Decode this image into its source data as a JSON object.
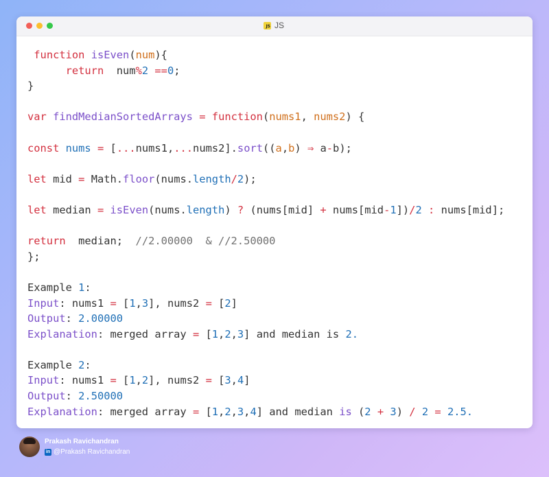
{
  "colors": {
    "keyword": "#d3303f",
    "function_name": "#7b4fc9",
    "parameter": "#d06f1b",
    "property": "#1f6fb6",
    "number": "#1f6fb6",
    "operator": "#d3303f",
    "comment": "#707070",
    "plain": "#333333",
    "dot_red": "#f25f58",
    "dot_yellow": "#fbbe2e",
    "dot_green": "#35c84a"
  },
  "window": {
    "tab_label": "JS",
    "tab_icon": "js-file-icon",
    "tab_icon_text": "JS"
  },
  "code": {
    "lines": [
      [
        {
          "t": " "
        },
        {
          "t": "function",
          "k": "keyword"
        },
        {
          "t": " "
        },
        {
          "t": "isEven",
          "k": "function_name"
        },
        {
          "t": "("
        },
        {
          "t": "num",
          "k": "parameter"
        },
        {
          "t": "){"
        }
      ],
      [
        {
          "t": "      "
        },
        {
          "t": "return",
          "k": "keyword"
        },
        {
          "t": "  num"
        },
        {
          "t": "%",
          "k": "operator"
        },
        {
          "t": "2",
          "k": "number"
        },
        {
          "t": " "
        },
        {
          "t": "==",
          "k": "operator"
        },
        {
          "t": "0",
          "k": "number"
        },
        {
          "t": ";"
        }
      ],
      [
        {
          "t": "}"
        }
      ],
      [],
      [
        {
          "t": "var",
          "k": "keyword"
        },
        {
          "t": " "
        },
        {
          "t": "findMedianSortedArrays",
          "k": "function_name"
        },
        {
          "t": " "
        },
        {
          "t": "=",
          "k": "operator"
        },
        {
          "t": " "
        },
        {
          "t": "function",
          "k": "keyword"
        },
        {
          "t": "("
        },
        {
          "t": "nums1",
          "k": "parameter"
        },
        {
          "t": ", "
        },
        {
          "t": "nums2",
          "k": "parameter"
        },
        {
          "t": ") {"
        }
      ],
      [],
      [
        {
          "t": "const",
          "k": "keyword"
        },
        {
          "t": " "
        },
        {
          "t": "nums",
          "k": "property"
        },
        {
          "t": " "
        },
        {
          "t": "=",
          "k": "operator"
        },
        {
          "t": " ["
        },
        {
          "t": "...",
          "k": "operator"
        },
        {
          "t": "nums1,"
        },
        {
          "t": "...",
          "k": "operator"
        },
        {
          "t": "nums2]."
        },
        {
          "t": "sort",
          "k": "function_name"
        },
        {
          "t": "(("
        },
        {
          "t": "a",
          "k": "parameter"
        },
        {
          "t": ","
        },
        {
          "t": "b",
          "k": "parameter"
        },
        {
          "t": ") "
        },
        {
          "t": "⇒",
          "k": "operator"
        },
        {
          "t": " a"
        },
        {
          "t": "-",
          "k": "operator"
        },
        {
          "t": "b);"
        }
      ],
      [],
      [
        {
          "t": "let",
          "k": "keyword"
        },
        {
          "t": " mid "
        },
        {
          "t": "=",
          "k": "operator"
        },
        {
          "t": " Math."
        },
        {
          "t": "floor",
          "k": "function_name"
        },
        {
          "t": "(nums."
        },
        {
          "t": "length",
          "k": "property"
        },
        {
          "t": "/",
          "k": "operator"
        },
        {
          "t": "2",
          "k": "number"
        },
        {
          "t": ");"
        }
      ],
      [],
      [
        {
          "t": "let",
          "k": "keyword"
        },
        {
          "t": " median "
        },
        {
          "t": "=",
          "k": "operator"
        },
        {
          "t": " "
        },
        {
          "t": "isEven",
          "k": "function_name"
        },
        {
          "t": "(nums."
        },
        {
          "t": "length",
          "k": "property"
        },
        {
          "t": ") "
        },
        {
          "t": "?",
          "k": "operator"
        },
        {
          "t": " (nums[mid] "
        },
        {
          "t": "+",
          "k": "operator"
        },
        {
          "t": " nums[mid"
        },
        {
          "t": "-",
          "k": "operator"
        },
        {
          "t": "1",
          "k": "number"
        },
        {
          "t": "])"
        },
        {
          "t": "/",
          "k": "operator"
        },
        {
          "t": "2",
          "k": "number"
        },
        {
          "t": " "
        },
        {
          "t": ":",
          "k": "operator"
        },
        {
          "t": " nums[mid];"
        }
      ],
      [],
      [
        {
          "t": "return",
          "k": "keyword"
        },
        {
          "t": "  median;  "
        },
        {
          "t": "//2.00000  & //2.50000",
          "k": "comment"
        }
      ],
      [
        {
          "t": "};"
        }
      ],
      [],
      [
        {
          "t": "Example "
        },
        {
          "t": "1",
          "k": "number"
        },
        {
          "t": ":"
        }
      ],
      [
        {
          "t": "Input",
          "k": "function_name"
        },
        {
          "t": ": nums1 "
        },
        {
          "t": "=",
          "k": "operator"
        },
        {
          "t": " ["
        },
        {
          "t": "1",
          "k": "number"
        },
        {
          "t": ","
        },
        {
          "t": "3",
          "k": "number"
        },
        {
          "t": "], nums2 "
        },
        {
          "t": "=",
          "k": "operator"
        },
        {
          "t": " ["
        },
        {
          "t": "2",
          "k": "number"
        },
        {
          "t": "]"
        }
      ],
      [
        {
          "t": "Output",
          "k": "function_name"
        },
        {
          "t": ": "
        },
        {
          "t": "2.00000",
          "k": "number"
        }
      ],
      [
        {
          "t": "Explanation",
          "k": "function_name"
        },
        {
          "t": ": merged array "
        },
        {
          "t": "=",
          "k": "operator"
        },
        {
          "t": " ["
        },
        {
          "t": "1",
          "k": "number"
        },
        {
          "t": ","
        },
        {
          "t": "2",
          "k": "number"
        },
        {
          "t": ","
        },
        {
          "t": "3",
          "k": "number"
        },
        {
          "t": "] and median is "
        },
        {
          "t": "2.",
          "k": "number"
        }
      ],
      [],
      [
        {
          "t": "Example "
        },
        {
          "t": "2",
          "k": "number"
        },
        {
          "t": ":"
        }
      ],
      [
        {
          "t": "Input",
          "k": "function_name"
        },
        {
          "t": ": nums1 "
        },
        {
          "t": "=",
          "k": "operator"
        },
        {
          "t": " ["
        },
        {
          "t": "1",
          "k": "number"
        },
        {
          "t": ","
        },
        {
          "t": "2",
          "k": "number"
        },
        {
          "t": "], nums2 "
        },
        {
          "t": "=",
          "k": "operator"
        },
        {
          "t": " ["
        },
        {
          "t": "3",
          "k": "number"
        },
        {
          "t": ","
        },
        {
          "t": "4",
          "k": "number"
        },
        {
          "t": "]"
        }
      ],
      [
        {
          "t": "Output",
          "k": "function_name"
        },
        {
          "t": ": "
        },
        {
          "t": "2.50000",
          "k": "number"
        }
      ],
      [
        {
          "t": "Explanation",
          "k": "function_name"
        },
        {
          "t": ": merged array "
        },
        {
          "t": "=",
          "k": "operator"
        },
        {
          "t": " ["
        },
        {
          "t": "1",
          "k": "number"
        },
        {
          "t": ","
        },
        {
          "t": "2",
          "k": "number"
        },
        {
          "t": ","
        },
        {
          "t": "3",
          "k": "number"
        },
        {
          "t": ","
        },
        {
          "t": "4",
          "k": "number"
        },
        {
          "t": "] and median "
        },
        {
          "t": "is",
          "k": "function_name"
        },
        {
          "t": " ("
        },
        {
          "t": "2",
          "k": "number"
        },
        {
          "t": " "
        },
        {
          "t": "+",
          "k": "operator"
        },
        {
          "t": " "
        },
        {
          "t": "3",
          "k": "number"
        },
        {
          "t": ") "
        },
        {
          "t": "/",
          "k": "operator"
        },
        {
          "t": " "
        },
        {
          "t": "2",
          "k": "number"
        },
        {
          "t": " "
        },
        {
          "t": "=",
          "k": "operator"
        },
        {
          "t": " "
        },
        {
          "t": "2.5.",
          "k": "number"
        }
      ]
    ]
  },
  "author": {
    "name": "Prakash Ravichandran",
    "handle": "@Prakash Ravichandran",
    "social_icon": "linkedin-icon",
    "social_icon_text": "in",
    "avatar_icon": "avatar-photo"
  }
}
